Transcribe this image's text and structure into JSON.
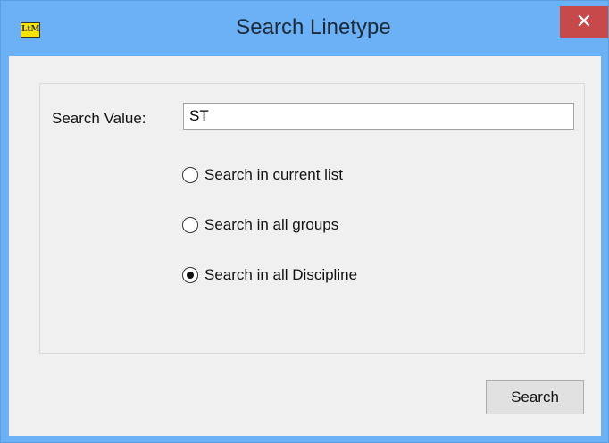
{
  "window": {
    "title": "Search Linetype",
    "app_icon_text": "LtM",
    "close_symbol": "✕"
  },
  "form": {
    "search_label": "Search Value:",
    "search_value": "ST",
    "options": [
      {
        "label": "Search in current list",
        "checked": false
      },
      {
        "label": "Search in all groups",
        "checked": false
      },
      {
        "label": "Search in all Discipline",
        "checked": true
      }
    ],
    "search_button_label": "Search"
  },
  "colors": {
    "titlebar": "#6cb1f5",
    "close_button": "#c8494a",
    "client_background": "#f0f0f0"
  }
}
